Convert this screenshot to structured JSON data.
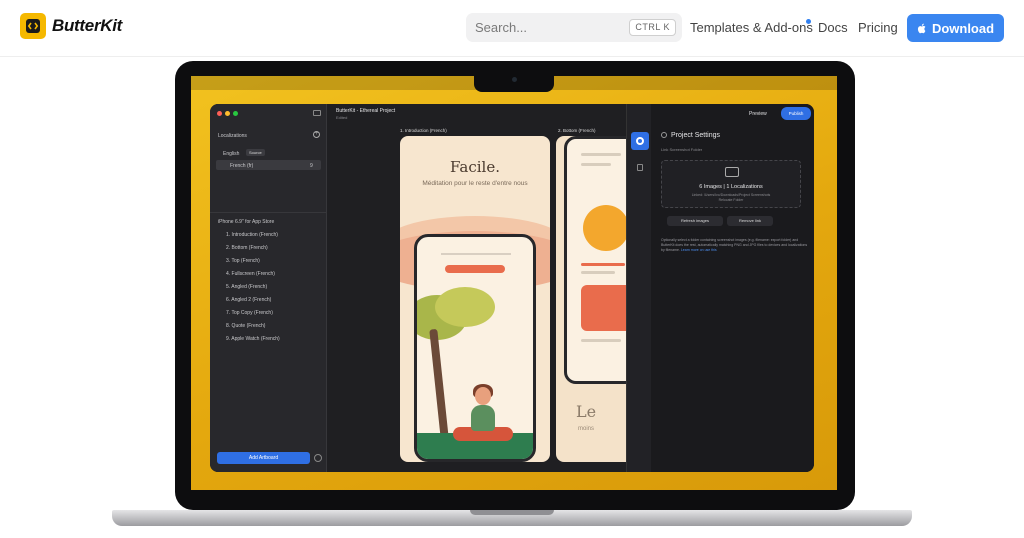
{
  "header": {
    "brand": "ButterKit",
    "search_placeholder": "Search...",
    "search_shortcut": "CTRL K",
    "nav_templates": "Templates & Add-ons",
    "nav_docs": "Docs",
    "nav_pricing": "Pricing",
    "download_label": "Download"
  },
  "app": {
    "sidebar": {
      "localizations_title": "Localizations",
      "language_english": "English",
      "source_badge": "Source",
      "language_french": "French (fr)",
      "language_french_count": "9",
      "device_group": "iPhone 6.9\" for App Store",
      "device_count": "9",
      "artboards": [
        "1. Introduction (French)",
        "2. Bottom (French)",
        "3. Top (French)",
        "4. Fullscreen (French)",
        "5. Angled (French)",
        "6. Angled 2 (French)",
        "7. Top Copy (French)",
        "8. Quote (French)",
        "9. Apple Watch (French)"
      ],
      "add_artboard": "Add Artboard"
    },
    "canvas": {
      "project_title": "ButterKit - Ethereal Project",
      "project_subtitle": "Edited",
      "artboard1_label": "1. Introduction (French)",
      "artboard1_title": "Facile.",
      "artboard1_subtitle": "Méditation pour le reste d'entre nous",
      "artboard2_label": "2. Bottom (French)",
      "artboard2_title": "Le",
      "artboard2_subtitle": "moins"
    },
    "panel": {
      "preview": "Preview",
      "publish": "Publish",
      "title": "Project Settings",
      "sub": "Link Screenshot Folder",
      "images_summary": "6 Images | 1 Localizations",
      "path_line1": "Linked: /Users/Ivo/Downloads/Project Screenshots",
      "path_line2": "Relocate Folder",
      "refresh": "Refresh images",
      "remove": "Remove link",
      "description": "Optionally select a folder containing screenshot images (e.g. filename: export folder) and ButterKit does the rest, automatically matching PNG and JPG files to devices and localizations by filename.",
      "learn_more": "Learn more on use this"
    }
  },
  "colors": {
    "accent": "#3a86f0",
    "screen": "#f2c21f",
    "artboard": "#f7e6cf",
    "coral": "#e96c4c"
  }
}
